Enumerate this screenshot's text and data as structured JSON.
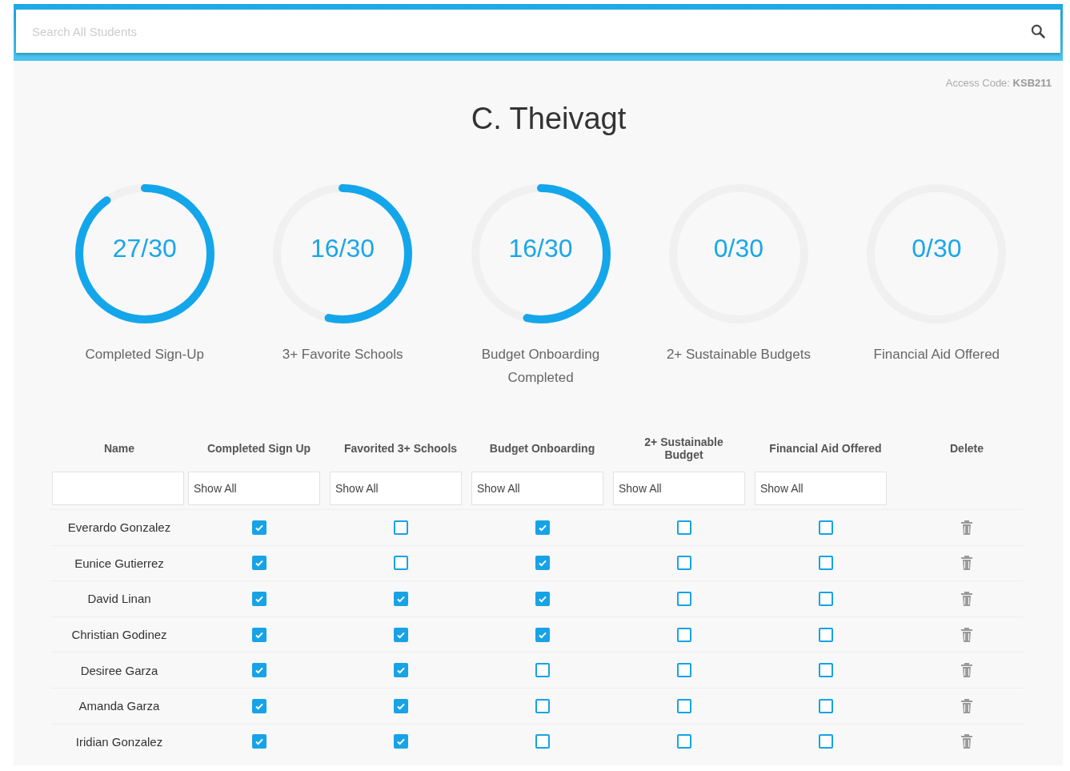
{
  "search": {
    "placeholder": "Search All Students"
  },
  "access_code": "Access Code: **KSB211**",
  "teacher_name": "C. Theivagt",
  "progress": [
    {
      "reading": "27/30",
      "label": "Completed Sign-Up"
    },
    {
      "reading": "16/30",
      "label": "3+ Favorite Schools"
    },
    {
      "reading": "16/30",
      "label": "Budget Onboarding Completed"
    },
    {
      "reading": "0/30",
      "label": "2+ Sustainable Budgets"
    },
    {
      "reading": "0/30",
      "label": "Financial Aid Offered"
    }
  ],
  "table": {
    "columns": [
      "Name",
      "Completed Sign Up",
      "Favorited 3+ Schools",
      "Budget Onboarding",
      "2+ Sustainable Budget",
      "Financial Aid Offered",
      "Delete"
    ],
    "filters": [
      {
        "kind": "text"
      },
      {
        "kind": "select",
        "value": "Show All"
      },
      {
        "kind": "select",
        "value": "Show All"
      },
      {
        "kind": "select",
        "value": "Show All"
      },
      {
        "kind": "select",
        "value": "Show All"
      },
      {
        "kind": "select",
        "value": "Show All"
      }
    ],
    "rows": [
      {
        "name": "Everardo Gonzalez",
        "checks": [
          {
            "checked": true
          },
          {
            "checked": false
          },
          {
            "checked": true
          },
          {
            "checked": false
          },
          {
            "checked": false
          }
        ]
      },
      {
        "name": "Eunice Gutierrez",
        "checks": [
          {
            "checked": true
          },
          {
            "checked": false
          },
          {
            "checked": true
          },
          {
            "checked": false
          },
          {
            "checked": false
          }
        ]
      },
      {
        "name": "David Linan",
        "checks": [
          {
            "checked": true
          },
          {
            "checked": true
          },
          {
            "checked": true
          },
          {
            "checked": false
          },
          {
            "checked": false
          }
        ]
      },
      {
        "name": "Christian Godinez",
        "checks": [
          {
            "checked": true
          },
          {
            "checked": true
          },
          {
            "checked": true
          },
          {
            "checked": false
          },
          {
            "checked": false
          }
        ]
      },
      {
        "name": "Desiree Garza",
        "checks": [
          {
            "checked": true
          },
          {
            "checked": true
          },
          {
            "checked": false
          },
          {
            "checked": false
          },
          {
            "checked": false
          }
        ]
      },
      {
        "name": "Amanda Garza",
        "checks": [
          {
            "checked": true
          },
          {
            "checked": true
          },
          {
            "checked": false
          },
          {
            "checked": false
          },
          {
            "checked": false
          }
        ]
      },
      {
        "name": "Iridian Gonzalez",
        "checks": [
          {
            "checked": true
          },
          {
            "checked": true
          },
          {
            "checked": false
          },
          {
            "checked": false
          },
          {
            "checked": false
          }
        ]
      }
    ]
  }
}
